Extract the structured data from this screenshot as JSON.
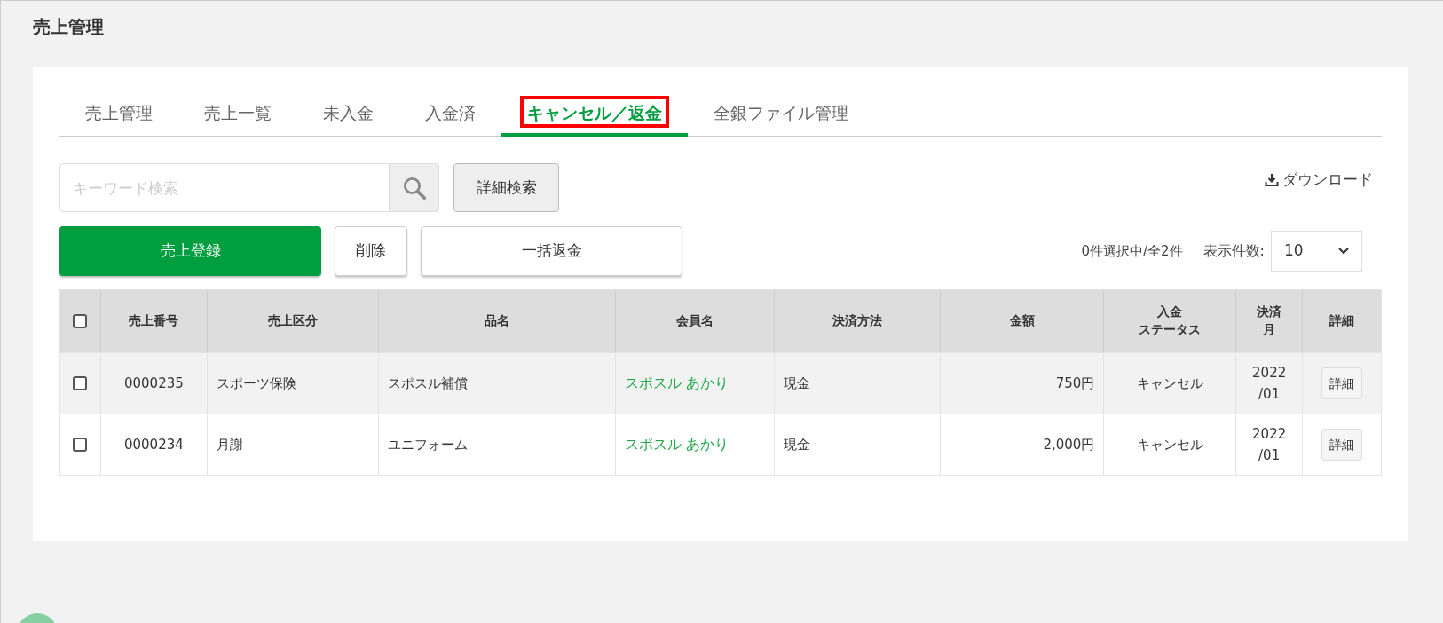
{
  "page_title": "売上管理",
  "tabs": [
    {
      "label": "売上管理",
      "selected": false
    },
    {
      "label": "売上一覧",
      "selected": false
    },
    {
      "label": "未入金",
      "selected": false
    },
    {
      "label": "入金済",
      "selected": false
    },
    {
      "label": "キャンセル／返金",
      "selected": true,
      "highlighted": true
    },
    {
      "label": "全銀ファイル管理",
      "selected": false
    }
  ],
  "search": {
    "placeholder": "キーワード検索"
  },
  "detail_search_button": "詳細検索",
  "download_link": "ダウンロード",
  "register_button": "売上登録",
  "delete_button": "削除",
  "bulk_refund_button": "一括返金",
  "selection_count": "0件選択中/全2件",
  "page_size": {
    "label": "表示件数:",
    "value": "10"
  },
  "table": {
    "select_all": {
      "checked": false
    },
    "columns": [
      {
        "lines": [
          "売上番号"
        ]
      },
      {
        "lines": [
          "売上区分"
        ]
      },
      {
        "lines": [
          "品名"
        ]
      },
      {
        "lines": [
          "会員名"
        ]
      },
      {
        "lines": [
          "決済方法"
        ]
      },
      {
        "lines": [
          "金額"
        ]
      },
      {
        "lines": [
          "入金",
          "ステータス"
        ]
      },
      {
        "lines": [
          "決済",
          "月"
        ]
      },
      {
        "lines": [
          "詳細"
        ]
      }
    ],
    "rows": [
      {
        "checked": false,
        "number": "0000235",
        "category": "スポーツ保険",
        "item": "スポスル補償",
        "member": "スポスル あかり",
        "payment": "現金",
        "amount": "750円",
        "status": "キャンセル",
        "month": "2022\n/01",
        "detail": "詳細"
      },
      {
        "checked": false,
        "number": "0000234",
        "category": "月謝",
        "item": "ユニフォーム",
        "member": "スポスル あかり",
        "payment": "現金",
        "amount": "2,000円",
        "status": "キャンセル",
        "month": "2022\n/01",
        "detail": "詳細"
      }
    ]
  }
}
